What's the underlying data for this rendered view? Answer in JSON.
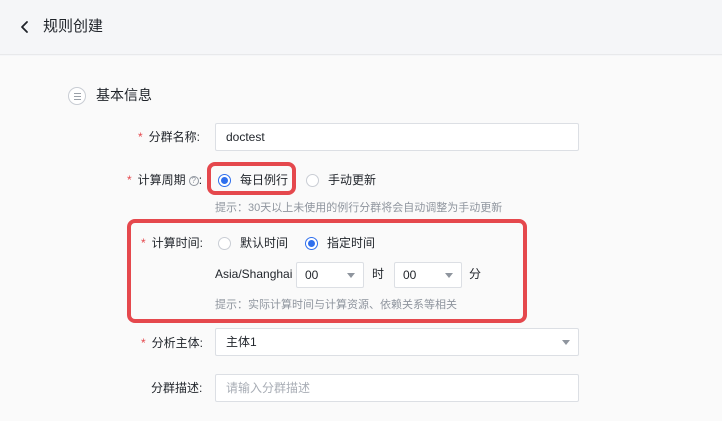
{
  "header": {
    "title": "规则创建"
  },
  "section": {
    "title": "基本信息"
  },
  "form": {
    "required_mark": "*",
    "group_name": {
      "label": "分群名称:",
      "value": "doctest"
    },
    "cycle": {
      "label": "计算周期",
      "help": "?",
      "colon": ":",
      "options": [
        "每日例行",
        "手动更新"
      ],
      "selected": "每日例行",
      "hint": "提示：30天以上未使用的例行分群将会自动调整为手动更新"
    },
    "time": {
      "label": "计算时间:",
      "options": [
        "默认时间",
        "指定时间"
      ],
      "selected": "指定时间",
      "timezone": "Asia/Shanghai",
      "hour": "00",
      "hour_unit": "时",
      "minute": "00",
      "minute_unit": "分",
      "hint": "提示：实际计算时间与计算资源、依赖关系等相关"
    },
    "subject": {
      "label": "分析主体:",
      "value": "主体1"
    },
    "description": {
      "label": "分群描述:",
      "placeholder": "请输入分群描述"
    }
  },
  "colors": {
    "accent": "#2f6fed",
    "required": "#e5484d",
    "highlight": "#e5484d"
  }
}
